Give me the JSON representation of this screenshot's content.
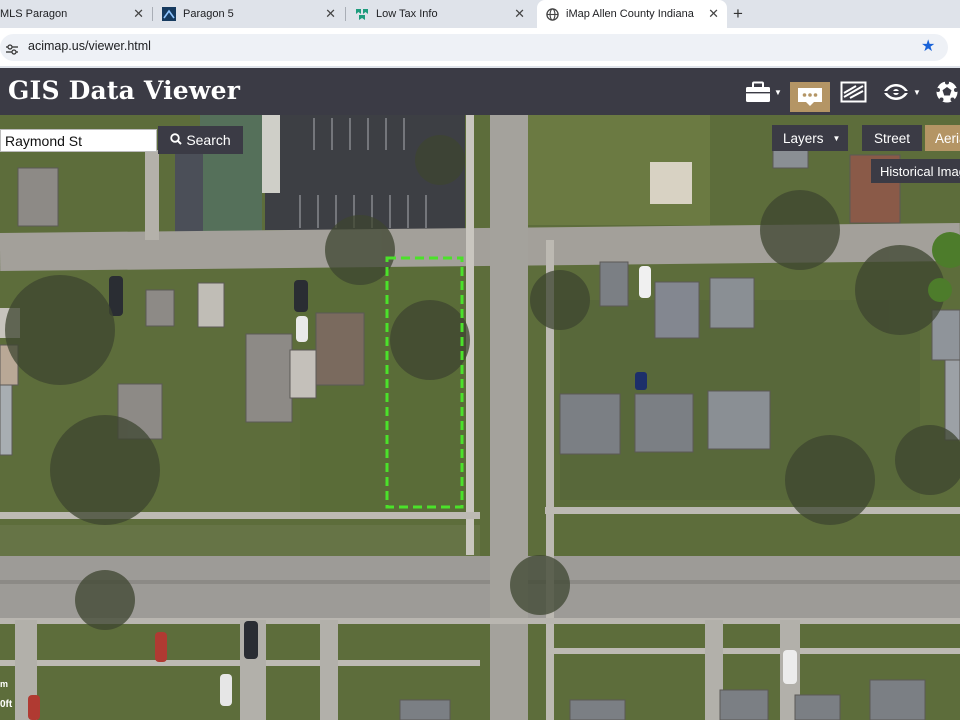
{
  "browser": {
    "tabs": [
      {
        "label": "MLS Paragon",
        "icon": "paragon-favicon"
      },
      {
        "label": "Paragon 5",
        "icon": "paragon-favicon"
      },
      {
        "label": "Low Tax Info",
        "icon": "lowtax-favicon"
      },
      {
        "label": "iMap Allen County Indiana",
        "icon": "globe-favicon",
        "active": true
      }
    ],
    "url": "acimap.us/viewer.html"
  },
  "gis": {
    "title": "GIS Data Viewer",
    "toolbar_icons": [
      "briefcase-icon",
      "comment-icon",
      "imagery-icon",
      "share-icon",
      "soccer-ball-icon"
    ]
  },
  "search": {
    "value": "Raymond St",
    "button_label": "Search"
  },
  "basemap": {
    "layers_label": "Layers",
    "street_label": "Street",
    "aerial_label": "Aerial",
    "historical_label": "Historical Imagery"
  },
  "scale": {
    "meters_label": "m",
    "feet_label": "0ft"
  },
  "colors": {
    "header": "#3b3b45",
    "accent": "#b49565",
    "parcel_highlight": "#4be22a",
    "star": "#1a63d8"
  }
}
